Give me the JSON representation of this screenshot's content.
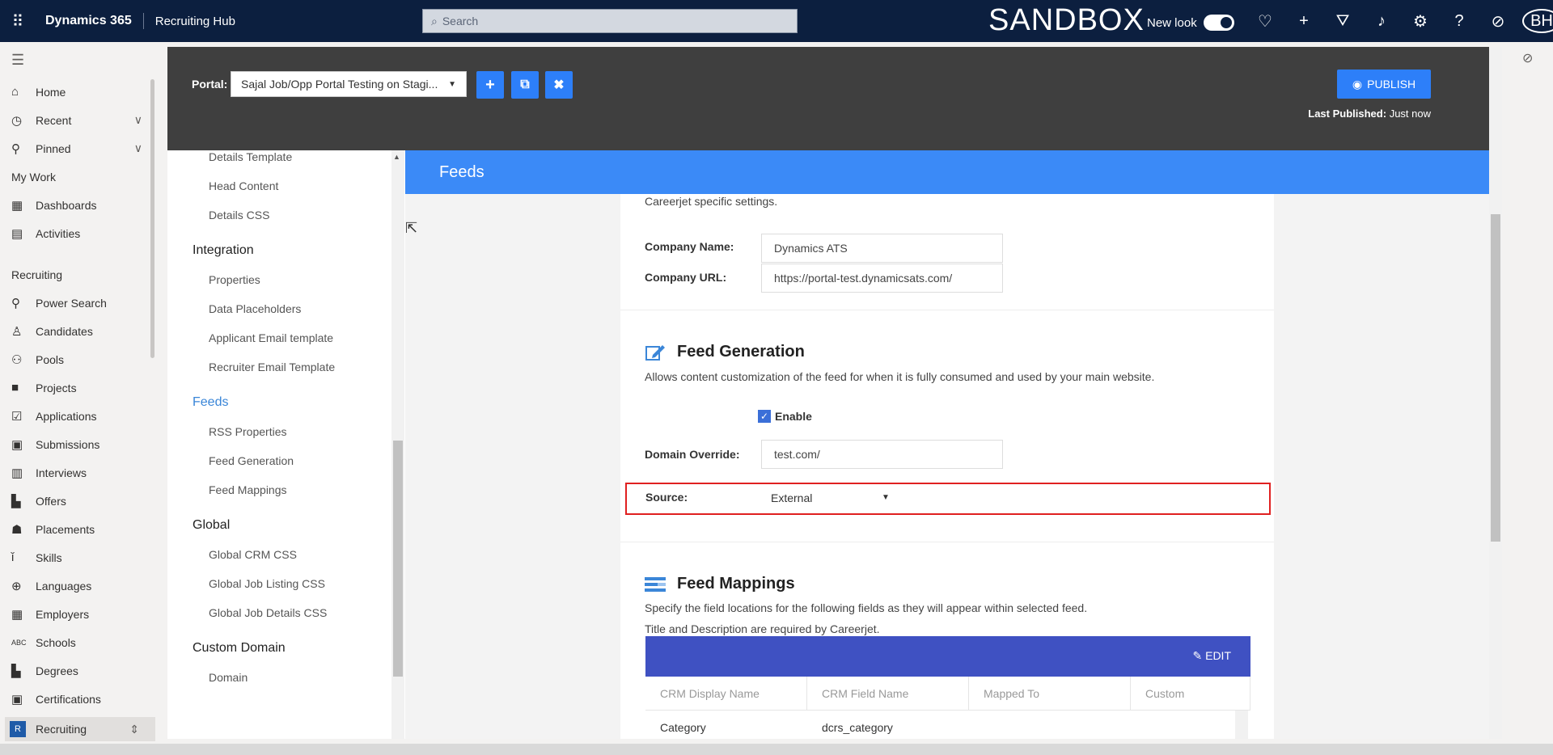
{
  "topbar": {
    "brand": "Dynamics 365",
    "app": "Recruiting Hub",
    "search_placeholder": "Search",
    "sandbox": "SANDBOX",
    "new_look": "New look",
    "avatar": "BH"
  },
  "nav": {
    "items_top": [
      {
        "label": "Home",
        "icon": "home-icon"
      },
      {
        "label": "Recent",
        "icon": "clock-icon"
      },
      {
        "label": "Pinned",
        "icon": "pin-icon"
      }
    ],
    "my_work": "My Work",
    "my_work_items": [
      {
        "label": "Dashboards"
      },
      {
        "label": "Activities"
      }
    ],
    "recruiting": "Recruiting",
    "recruiting_items": [
      {
        "label": "Power Search"
      },
      {
        "label": "Candidates"
      },
      {
        "label": "Pools"
      },
      {
        "label": "Projects"
      },
      {
        "label": "Applications"
      },
      {
        "label": "Submissions"
      },
      {
        "label": "Interviews"
      },
      {
        "label": "Offers"
      },
      {
        "label": "Placements"
      },
      {
        "label": "Skills"
      },
      {
        "label": "Languages"
      },
      {
        "label": "Employers"
      },
      {
        "label": "Schools"
      },
      {
        "label": "Degrees"
      },
      {
        "label": "Certifications"
      }
    ],
    "area_badge": "R",
    "area_label": "Recruiting"
  },
  "portal": {
    "label": "Portal:",
    "selected": "Sajal Job/Opp Portal Testing on Stagi...",
    "publish": "PUBLISH",
    "last_published_label": "Last Published:",
    "last_published_value": "Just now"
  },
  "settings_nav": {
    "top_items": [
      "Details Template",
      "Head Content",
      "Details CSS"
    ],
    "integration": "Integration",
    "integration_items": [
      "Properties",
      "Data Placeholders",
      "Applicant Email template",
      "Recruiter Email Template"
    ],
    "feeds": "Feeds",
    "feeds_items": [
      "RSS Properties",
      "Feed Generation",
      "Feed Mappings"
    ],
    "global": "Global",
    "global_items": [
      "Global CRM CSS",
      "Global Job Listing CSS",
      "Global Job Details CSS"
    ],
    "custom_domain": "Custom Domain",
    "custom_domain_items": [
      "Domain"
    ]
  },
  "main": {
    "title": "Feeds",
    "careerjet_note": "Careerjet specific settings.",
    "company_name_label": "Company Name:",
    "company_name_value": "Dynamics ATS",
    "company_url_label": "Company URL:",
    "company_url_value": "https://portal-test.dynamicsats.com/",
    "feed_gen_title": "Feed Generation",
    "feed_gen_desc": "Allows content customization of the feed for when it is fully consumed and used by your main website.",
    "enable_label": "Enable",
    "enable_checked": true,
    "domain_override_label": "Domain Override:",
    "domain_override_value": "test.com/",
    "source_label": "Source:",
    "source_value": "External",
    "feed_map_title": "Feed Mappings",
    "feed_map_desc1": "Specify the field locations for the following fields as they will appear within selected feed.",
    "feed_map_desc2": "Title and Description are required by Careerjet.",
    "edit_label": "EDIT",
    "columns": [
      "CRM Display Name",
      "CRM Field Name",
      "Mapped To",
      "Custom"
    ],
    "rows": [
      [
        "Category",
        "dcrs_category",
        "",
        ""
      ]
    ]
  }
}
